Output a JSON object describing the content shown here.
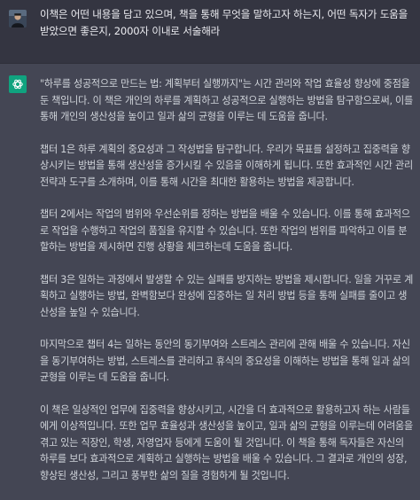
{
  "user_message": {
    "avatar_icon": "user-photo-avatar",
    "text": "이책은 어떤 내용을 담고 있으며, 책을 통해 무엇을 말하고자 하는지, 어떤 독자가 도움을 받았으면 좋은지, 2000자 이내로 서술해라"
  },
  "assistant_message": {
    "avatar_icon": "chatgpt-logo-icon",
    "avatar_color": "#10a37f",
    "paragraphs": [
      "\"하루를 성공적으로 만드는 법: 계획부터 실행까지\"는 시간 관리와 작업 효율성 향상에 중점을 둔 책입니다. 이 책은 개인의 하루를 계획하고 성공적으로 실행하는 방법을 탐구함으로써, 이를 통해 개인의 생산성을 높이고 일과 삶의 균형을 이루는 데 도움을 줍니다.",
      "챕터 1은 하루 계획의 중요성과 그 작성법을 탐구합니다. 우리가 목표를 설정하고 집중력을 향상시키는 방법을 통해 생산성을 증가시킬 수 있음을 이해하게 됩니다. 또한 효과적인 시간 관리 전략과 도구를 소개하며, 이를 통해 시간을 최대한 활용하는 방법을 제공합니다.",
      "챕터 2에서는 작업의 범위와 우선순위를 정하는 방법을 배울 수 있습니다. 이를 통해 효과적으로 작업을 수행하고 작업의 품질을 유지할 수 있습니다. 또한 작업의 범위를 파악하고 이를 분할하는 방법을 제시하면 진행 상황을 체크하는데 도움을 줍니다.",
      "챕터 3은 일하는 과정에서 발생할 수 있는 실패를 방지하는 방법을 제시합니다. 일을 거꾸로 계획하고 실행하는 방법, 완벽함보다 완성에 집중하는 일 처리 방법 등을 통해 실패를 줄이고 생산성을 높일 수 있습니다.",
      "마지막으로 챕터 4는 일하는 동안의 동기부여와 스트레스 관리에 관해 배울 수 있습니다. 자신을 동기부여하는 방법, 스트레스를 관리하고 휴식의 중요성을 이해하는 방법을 통해 일과 삶의 균형을 이루는 데 도움을 줍니다.",
      "이 책은 일상적인 업무에 집중력을 향상시키고, 시간을 더 효과적으로 활용하고자 하는 사람들에게 이상적입니다. 또한 업무 효율성과 생산성을 높이고, 일과 삶의 균형을 이루는데 어려움을 겪고 있는 직장인, 학생, 자영업자 등에게 도움이 될 것입니다. 이 책을 통해 독자들은 자신의 하루를 보다 효과적으로 계획하고 실행하는 방법을 배울 수 있습니다. 그 결과로 개인의 성장, 향상된 생산성, 그리고 풍부한 삶의 질을 경험하게 될 것입니다."
    ]
  }
}
